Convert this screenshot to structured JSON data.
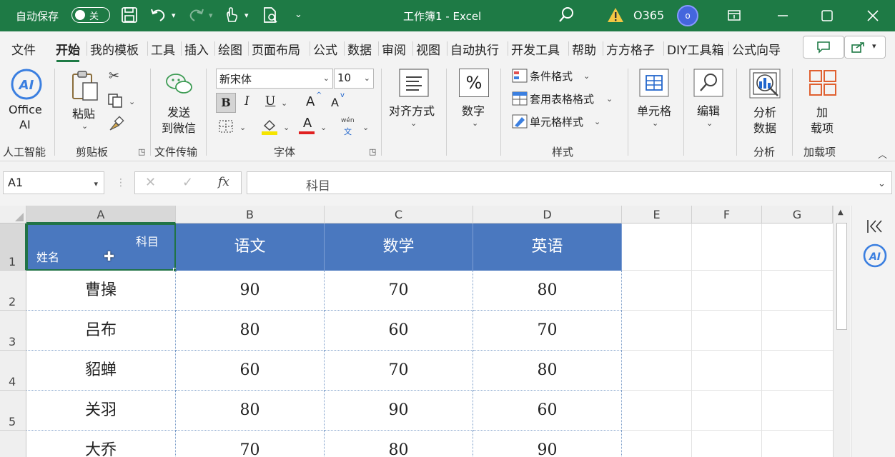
{
  "titlebar": {
    "autosave_label": "自动保存",
    "autosave_state": "关",
    "doc_title": "工作簿1  -  Excel",
    "account": "O365",
    "avatar_initial": "o",
    "bg_color": "#1e7a45"
  },
  "tabs": [
    {
      "label": "文件"
    },
    {
      "label": "开始"
    },
    {
      "label": "我的模板"
    },
    {
      "label": "工具"
    },
    {
      "label": "插入"
    },
    {
      "label": "绘图"
    },
    {
      "label": "页面布局"
    },
    {
      "label": "公式"
    },
    {
      "label": "数据"
    },
    {
      "label": "审阅"
    },
    {
      "label": "视图"
    },
    {
      "label": "自动执行"
    },
    {
      "label": "开发工具"
    },
    {
      "label": "帮助"
    },
    {
      "label": "方方格子"
    },
    {
      "label": "DIY工具箱"
    },
    {
      "label": "公式向导"
    }
  ],
  "ribbon": {
    "ai": {
      "label_line1": "Office",
      "label_line2": "AI",
      "group": "人工智能"
    },
    "clipboard": {
      "paste": "粘贴",
      "group": "剪贴板"
    },
    "transfer": {
      "line1": "发送",
      "line2": "到微信",
      "group": "文件传输"
    },
    "font": {
      "name": "新宋体",
      "size": "10",
      "bold": "B",
      "italic": "I",
      "underline": "U",
      "grow": "A",
      "shrink": "A",
      "fontcolor": "A",
      "phonetic_top": "wén",
      "phonetic_bottom": "文",
      "group": "字体"
    },
    "alignment": {
      "label": "对齐方式"
    },
    "number": {
      "symbol": "%",
      "label": "数字"
    },
    "styles": {
      "conditional": "条件格式",
      "table": "套用表格格式",
      "cell": "单元格样式",
      "group": "样式"
    },
    "cells": {
      "label": "单元格"
    },
    "editing": {
      "label": "编辑"
    },
    "analysis": {
      "line1": "分析",
      "line2": "数据",
      "group": "分析"
    },
    "addins": {
      "line1": "加",
      "line2": "载项",
      "group": "加载项"
    }
  },
  "formula_bar": {
    "namebox": "A1",
    "fx": "fx",
    "content": "科目"
  },
  "sheet": {
    "columns": [
      "A",
      "B",
      "C",
      "D",
      "E",
      "F",
      "G"
    ],
    "rows": [
      "1",
      "2",
      "3",
      "4",
      "5"
    ],
    "header_diag_top": "科目",
    "header_diag_bottom": "姓名",
    "subject_headers": [
      "语文",
      "数学",
      "英语"
    ],
    "data": [
      {
        "name": "曹操",
        "scores": [
          "90",
          "70",
          "80"
        ]
      },
      {
        "name": "吕布",
        "scores": [
          "80",
          "60",
          "70"
        ]
      },
      {
        "name": "貂蝉",
        "scores": [
          "60",
          "70",
          "80"
        ]
      },
      {
        "name": "关羽",
        "scores": [
          "80",
          "90",
          "60"
        ]
      },
      {
        "name": "大乔",
        "scores": [
          "70",
          "80",
          "90"
        ]
      }
    ],
    "header_fill": "#4a78bf"
  }
}
